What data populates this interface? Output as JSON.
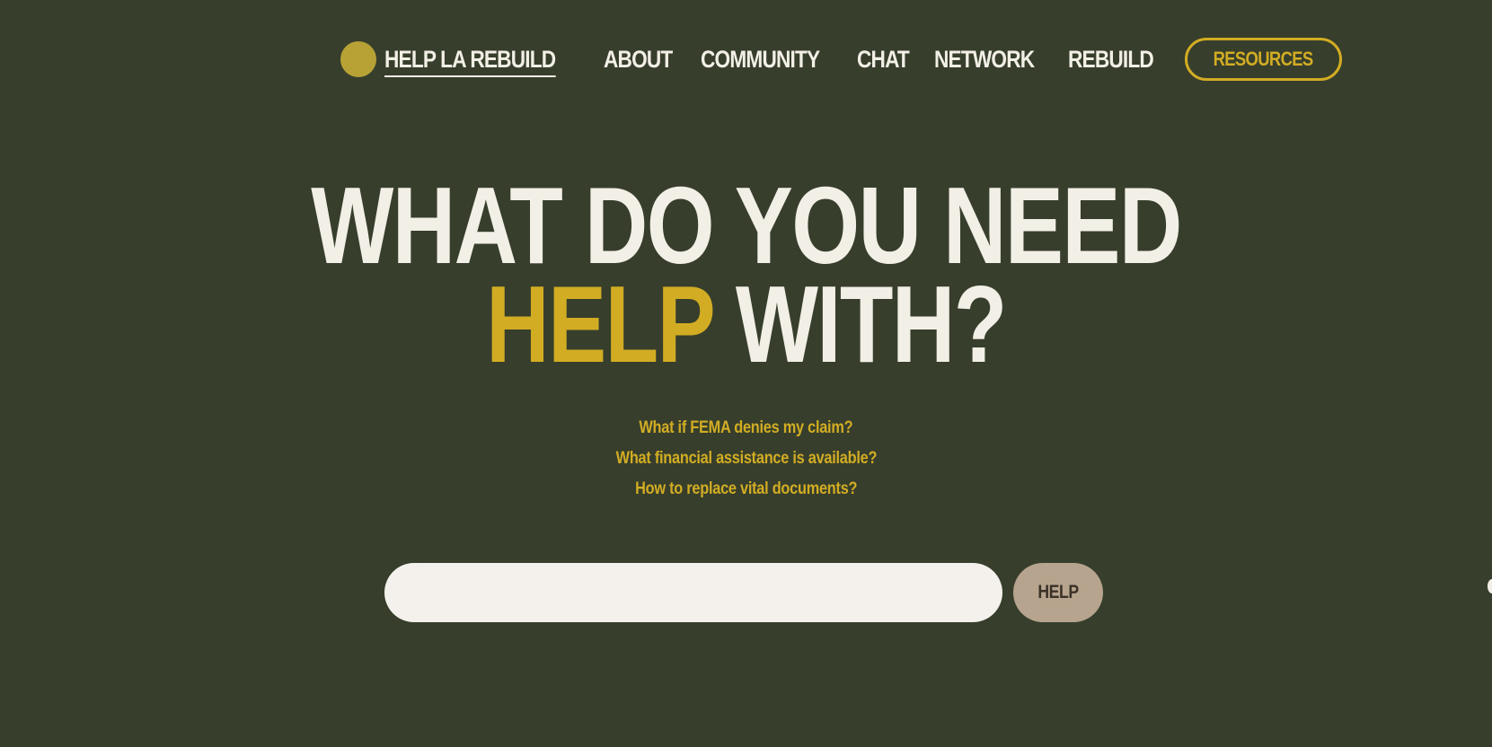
{
  "nav": {
    "brand_label": "HELP LA REBUILD",
    "links": [
      {
        "label": "ABOUT"
      },
      {
        "label": "COMMUNITY"
      },
      {
        "label": "CHAT"
      },
      {
        "label": "NETWORK"
      },
      {
        "label": "REBUILD"
      }
    ],
    "resources_label": "RESOURCES"
  },
  "hero": {
    "line1": "WHAT DO YOU NEED",
    "line2_accent": "HELP",
    "line2_rest": " WITH?"
  },
  "suggestions": [
    "What if FEMA denies my claim?",
    "What financial assistance is available?",
    "How to replace vital documents?"
  ],
  "search": {
    "value": "",
    "placeholder": "",
    "button_label": "HELP"
  },
  "colors": {
    "background": "#373f2c",
    "accent": "#d2ad24",
    "text_light": "#f2efe7",
    "logo": "#b8a236",
    "button": "#b6a48f"
  }
}
